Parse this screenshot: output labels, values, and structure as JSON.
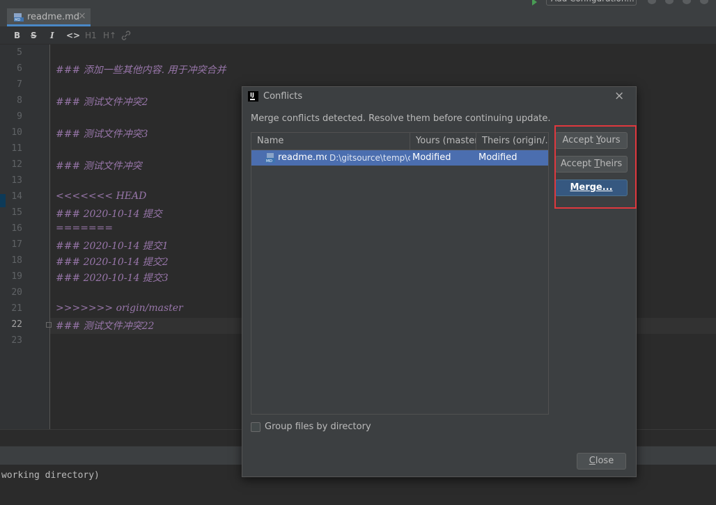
{
  "window": {
    "run_config_label": "Add Configuration..."
  },
  "editor_tab": {
    "file_name": "readme.md",
    "close_glyph": "×"
  },
  "toolbar": {
    "bold": "B",
    "strike": "S",
    "italic": "I",
    "code": "<>",
    "header1": "H1",
    "header2": "H↑",
    "link_icon": "link-icon"
  },
  "editor": {
    "lines": [
      {
        "num": "5",
        "text": ""
      },
      {
        "num": "6",
        "text": "### 添加一些其他内容. 用于冲突合并"
      },
      {
        "num": "7",
        "text": ""
      },
      {
        "num": "8",
        "text": "### 测试文件冲突2"
      },
      {
        "num": "9",
        "text": ""
      },
      {
        "num": "10",
        "text": "### 测试文件冲突3"
      },
      {
        "num": "11",
        "text": ""
      },
      {
        "num": "12",
        "text": "### 测试文件冲突"
      },
      {
        "num": "13",
        "text": ""
      },
      {
        "num": "14",
        "text": "<<<<<<< HEAD"
      },
      {
        "num": "15",
        "text": "### 2020-10-14 提交"
      },
      {
        "num": "16",
        "text": "======="
      },
      {
        "num": "17",
        "text": "### 2020-10-14 提交1"
      },
      {
        "num": "18",
        "text": "### 2020-10-14 提交2"
      },
      {
        "num": "19",
        "text": "### 2020-10-14 提交3"
      },
      {
        "num": "20",
        "text": ""
      },
      {
        "num": "21",
        "text": ">>>>>>> origin/master"
      },
      {
        "num": "22",
        "text": "### 测试文件冲突22"
      },
      {
        "num": "23",
        "text": ""
      }
    ]
  },
  "console": {
    "text": "working directory)"
  },
  "dialog": {
    "title": "Conflicts",
    "message": "Merge conflicts detected. Resolve them before continuing update.",
    "columns": [
      "Name",
      "Yours (master)",
      "Theirs (origin/..."
    ],
    "rows": [
      {
        "file": "readme.md",
        "path": "D:\\gitsource\\temp\\c",
        "yours": "Modified",
        "theirs": "Modified"
      }
    ],
    "buttons": {
      "accept_yours_pre": "Accept ",
      "accept_yours_mnemonic": "Y",
      "accept_yours_post": "ours",
      "accept_theirs_pre": "Accept ",
      "accept_theirs_mnemonic": "T",
      "accept_theirs_post": "heirs",
      "merge": "Merge...",
      "close_mnemonic": "C",
      "close_post": "lose"
    },
    "group_by_directory": "Group files by directory",
    "close_glyph": "×",
    "highlight_color": "#e0383e"
  }
}
